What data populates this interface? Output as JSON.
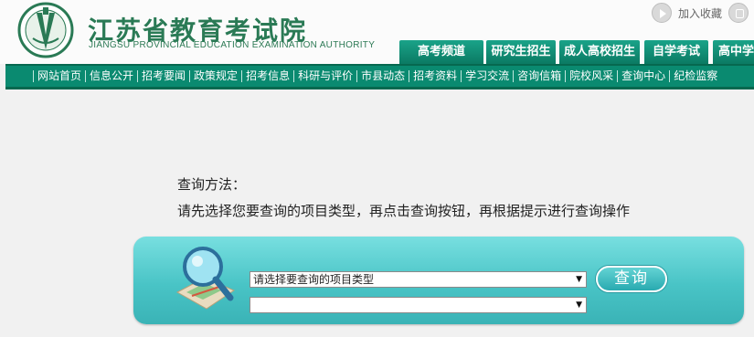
{
  "header": {
    "title_zh": "江苏省教育考试院",
    "title_en": "JIANGSU PROVINCIAL EDUCATION EXAMINATION AUTHORITY",
    "favorite_label": "加入收藏"
  },
  "tabs": [
    {
      "label": "高考频道"
    },
    {
      "label": "研究生招生"
    },
    {
      "label": "成人高校招生"
    },
    {
      "label": "自学考试"
    },
    {
      "label": "高中学"
    }
  ],
  "nav": [
    {
      "label": "网站首页"
    },
    {
      "label": "信息公开"
    },
    {
      "label": "招考要闻"
    },
    {
      "label": "政策规定"
    },
    {
      "label": "招考信息"
    },
    {
      "label": "科研与评价"
    },
    {
      "label": "市县动态"
    },
    {
      "label": "招考资料"
    },
    {
      "label": "学习交流"
    },
    {
      "label": "咨询信箱"
    },
    {
      "label": "院校风采"
    },
    {
      "label": "查询中心"
    },
    {
      "label": "纪检监察"
    }
  ],
  "content": {
    "method_label": "查询方法：",
    "method_text": "请先选择您要查询的项目类型，再点击查询按钮，再根据提示进行查询操作"
  },
  "query": {
    "project_type_select": "请选择要查询的项目类型",
    "sub_select": "",
    "button_label": "查询"
  },
  "colors": {
    "brand_green": "#0a8a70",
    "panel_cyan": "#49c4c6"
  }
}
